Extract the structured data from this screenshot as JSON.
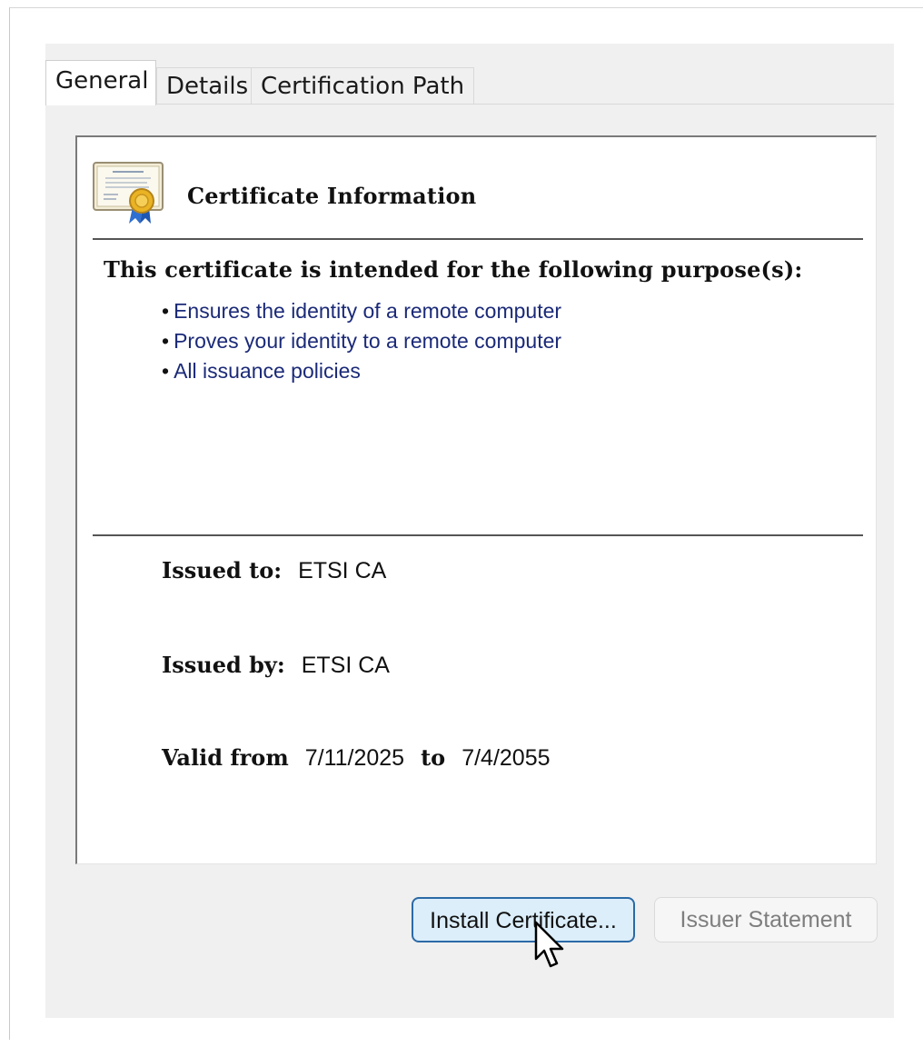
{
  "tabs": [
    {
      "label": "General",
      "active": true
    },
    {
      "label": "Details",
      "active": false
    },
    {
      "label": "Certification Path",
      "active": false
    }
  ],
  "certificate": {
    "icon": "certificate-icon",
    "title": "Certificate Information",
    "purpose_heading": "This certificate is intended for the following purpose(s):",
    "purposes": [
      "Ensures the identity of a remote computer",
      "Proves your identity to a remote computer",
      "All issuance policies"
    ],
    "issued_to_label": "Issued to:",
    "issued_to": "ETSI CA",
    "issued_by_label": "Issued by:",
    "issued_by": "ETSI CA",
    "valid_from_label": "Valid from",
    "valid_from": "7/11/2025",
    "valid_to_label": "to",
    "valid_to": "7/4/2055"
  },
  "buttons": {
    "install": "Install Certificate...",
    "issuer_statement": "Issuer Statement"
  },
  "colors": {
    "purpose_text": "#1b2a78",
    "install_border": "#2b6aa6",
    "install_fill": "#dceefa",
    "disabled_text": "#7e7e7e"
  },
  "cursor": "arrow-cursor"
}
